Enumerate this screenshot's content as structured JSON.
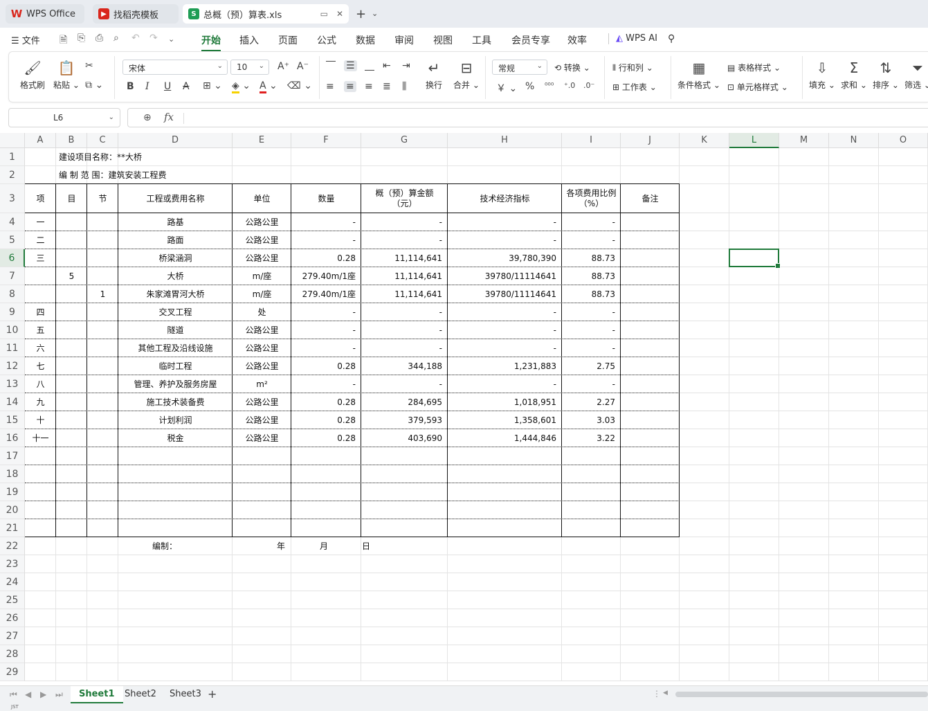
{
  "tabs": [
    {
      "label": "WPS Office",
      "icon": "wps-logo-icon"
    },
    {
      "label": "找稻壳模板",
      "icon": "docer-icon"
    },
    {
      "label": "总概（预）算表.xls",
      "icon": "spreadsheet-icon",
      "icon_text": "S"
    }
  ],
  "menu": {
    "file": "文件",
    "items": [
      "开始",
      "插入",
      "页面",
      "公式",
      "数据",
      "审阅",
      "视图",
      "工具",
      "会员专享",
      "效率"
    ],
    "active": "开始",
    "ai": "WPS AI"
  },
  "ribbon": {
    "format_painter": "格式刷",
    "paste": "粘贴",
    "font_name": "宋体",
    "font_size": "10",
    "wrap": "换行",
    "merge": "合并",
    "number_format": "常规",
    "convert": "转换",
    "rows_cols": "行和列",
    "worksheet": "工作表",
    "cond_format": "条件格式",
    "table_style": "表格样式",
    "cell_style": "单元格样式",
    "fill": "填充",
    "sum": "求和",
    "sort": "排序",
    "filter": "筛选",
    "currency": "￥",
    "percent": "%"
  },
  "formula_bar": {
    "cell_ref": "L6",
    "fx": "fx",
    "value": ""
  },
  "columns": [
    "A",
    "B",
    "C",
    "D",
    "E",
    "F",
    "G",
    "H",
    "I",
    "J",
    "K",
    "L",
    "M",
    "N",
    "O"
  ],
  "selected_column": "L",
  "selected_row": "6",
  "sheet": {
    "project_name": "建设项目名称：**大桥",
    "scope": "编 制 范 围：建筑安装工程费",
    "headers": [
      "项",
      "目",
      "节",
      "工程或费用名称",
      "单位",
      "数量",
      "概（预）算金额",
      "技术经济指标",
      "各项费用比例",
      "备注"
    ],
    "header_sub": {
      "amount": "（元）",
      "ratio": "（%）"
    },
    "rows": [
      [
        "一",
        "",
        "",
        "路基",
        "公路公里",
        "-",
        "-",
        "-",
        "-",
        ""
      ],
      [
        "二",
        "",
        "",
        "路面",
        "公路公里",
        "-",
        "-",
        "-",
        "-",
        ""
      ],
      [
        "三",
        "",
        "",
        "桥梁涵洞",
        "公路公里",
        "0.28",
        "11,114,641",
        "39,780,390",
        "88.73",
        ""
      ],
      [
        "",
        "5",
        "",
        "大桥",
        "m/座",
        "279.40m/1座",
        "11,114,641",
        "39780/11114641",
        "88.73",
        ""
      ],
      [
        "",
        "",
        "1",
        "朱家滩胃河大桥",
        "m/座",
        "279.40m/1座",
        "11,114,641",
        "39780/11114641",
        "88.73",
        ""
      ],
      [
        "四",
        "",
        "",
        "交叉工程",
        "处",
        "-",
        "-",
        "-",
        "-",
        ""
      ],
      [
        "五",
        "",
        "",
        "隧道",
        "公路公里",
        "-",
        "-",
        "-",
        "-",
        ""
      ],
      [
        "六",
        "",
        "",
        "其他工程及沿线设施",
        "公路公里",
        "-",
        "-",
        "-",
        "-",
        ""
      ],
      [
        "七",
        "",
        "",
        "临时工程",
        "公路公里",
        "0.28",
        "344,188",
        "1,231,883",
        "2.75",
        ""
      ],
      [
        "八",
        "",
        "",
        "管理、养护及服务房屋",
        "m²",
        "-",
        "-",
        "-",
        "-",
        ""
      ],
      [
        "九",
        "",
        "",
        "施工技术装备费",
        "公路公里",
        "0.28",
        "284,695",
        "1,018,951",
        "2.27",
        ""
      ],
      [
        "十",
        "",
        "",
        "计划利润",
        "公路公里",
        "0.28",
        "379,593",
        "1,358,601",
        "3.03",
        ""
      ],
      [
        "十一",
        "",
        "",
        "税金",
        "公路公里",
        "0.28",
        "403,690",
        "1,444,846",
        "3.22",
        ""
      ]
    ],
    "footer": {
      "prepared": "编制：",
      "year": "年",
      "month": "月",
      "day": "日"
    }
  },
  "sheet_tabs": [
    "Sheet1",
    "Sheet2",
    "Sheet3"
  ],
  "active_sheet": "Sheet1",
  "status_text": "JST",
  "accent_color": "#1f7a3a"
}
